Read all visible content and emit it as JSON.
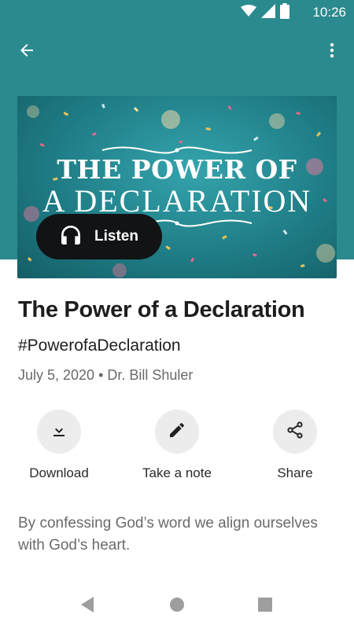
{
  "status_bar": {
    "time": "10:26",
    "icons": [
      "wifi-icon",
      "signal-icon",
      "battery-icon"
    ]
  },
  "app_bar": {
    "back_icon": "arrow-left-icon",
    "menu_icon": "more-vertical-icon"
  },
  "colors": {
    "header_bg": "#2b8a8e",
    "listen_button_bg": "#111315",
    "action_circle_bg": "#ececec"
  },
  "hero": {
    "line1": "THE POWER OF",
    "line2": "A DECLARATION"
  },
  "listen_button": {
    "label": "Listen",
    "icon": "headphones-icon"
  },
  "sermon": {
    "title": "The Power of a Declaration",
    "hashtag": "#PowerofaDeclaration",
    "meta": "July 5, 2020 • Dr. Bill Shuler",
    "description": "By confessing God’s word we align ourselves with God’s heart."
  },
  "actions": [
    {
      "label": "Download",
      "icon": "download-icon"
    },
    {
      "label": "Take a note",
      "icon": "pencil-icon"
    },
    {
      "label": "Share",
      "icon": "share-icon"
    }
  ],
  "nav_bar": {
    "icons": [
      "back-triangle-icon",
      "home-circle-icon",
      "recents-square-icon"
    ]
  }
}
